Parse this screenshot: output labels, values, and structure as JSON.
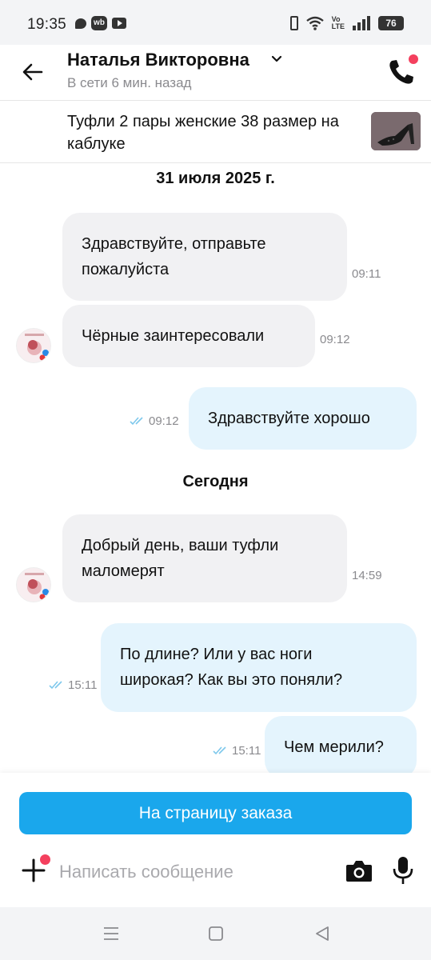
{
  "status_bar": {
    "time": "19:35",
    "wb_label": "wb",
    "volte_top": "Vo",
    "volte_bottom": "LTE",
    "battery": "76"
  },
  "header": {
    "contact_name": "Наталья Викторовна",
    "contact_status": "В сети 6 мин. назад",
    "icons": [
      "back-arrow-icon",
      "chevron-down-icon",
      "phone-icon"
    ],
    "accent_dot_color": "#f4405e"
  },
  "product": {
    "title": "Туфли 2 пары женские 38 размер на каблуке"
  },
  "chat": {
    "date_1": "31 июля 2025 г.",
    "date_2": "Сегодня",
    "messages": [
      {
        "direction": "in",
        "text_line1": "Здравствуйте, отправьте",
        "text_line2": "пожалуйста",
        "time": "09:11"
      },
      {
        "direction": "in",
        "text_line1": "Чёрные заинтересовали",
        "time": "09:12"
      },
      {
        "direction": "out",
        "text_line1": "Здравствуйте хорошо",
        "time": "09:12"
      },
      {
        "direction": "in",
        "text_line1": "Добрый день, ваши туфли",
        "text_line2": "маломерят",
        "time": "14:59"
      },
      {
        "direction": "out",
        "text_line1": "По длине? Или у вас ноги",
        "text_line2": "широкая? Как вы это поняли?",
        "time": "15:11"
      },
      {
        "direction": "out",
        "text_line1": "Чем мерили?",
        "time": "15:11"
      }
    ]
  },
  "bottom": {
    "order_button": "На страницу заказа",
    "input_placeholder": "Написать сообщение",
    "input_value": "",
    "icons": [
      "plus-icon",
      "camera-icon",
      "microphone-icon"
    ]
  },
  "colors": {
    "primary_button": "#1aa7ec",
    "incoming_bubble": "#f1f1f3",
    "outgoing_bubble": "#e4f4fd",
    "read_ticks": "#7ec8ec"
  }
}
